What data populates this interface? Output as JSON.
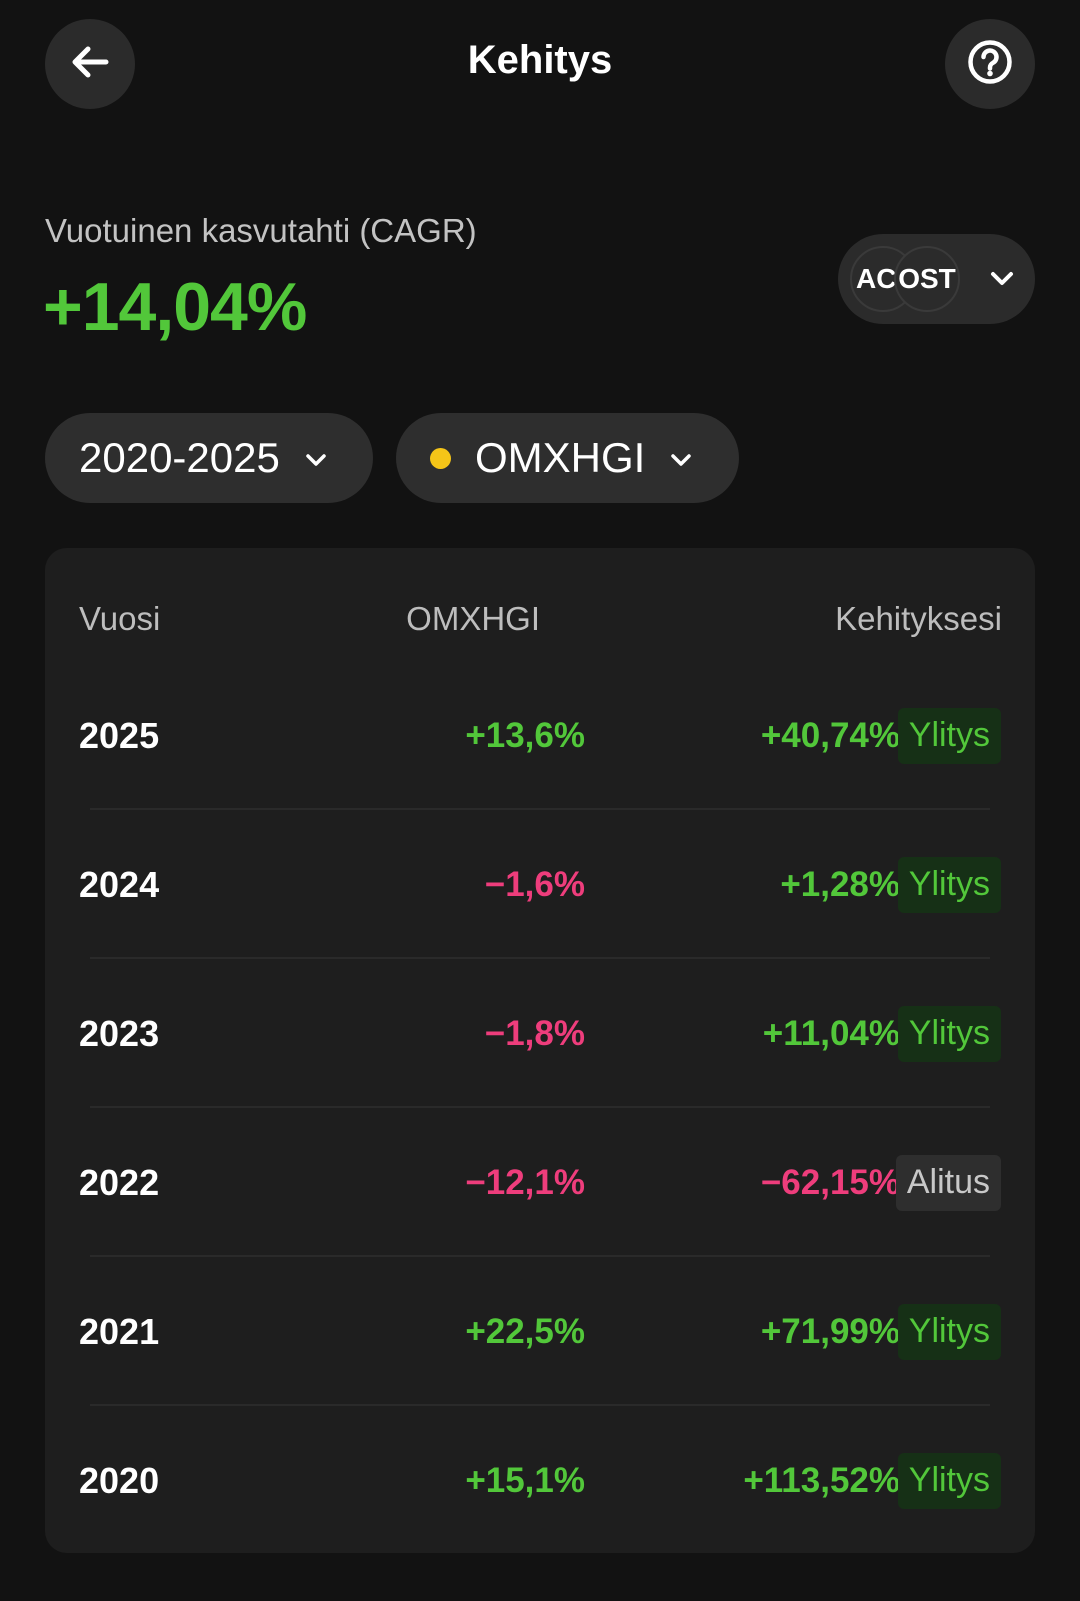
{
  "header": {
    "title": "Kehitys"
  },
  "cagr": {
    "label": "Vuotuinen kasvutahti (CAGR)",
    "value": "+14,04%"
  },
  "accounts": {
    "first": "AC",
    "second": "OST"
  },
  "filters": {
    "period": "2020-2025",
    "index": "OMXHGI",
    "index_dot_color": "#f5c518"
  },
  "table": {
    "headers": {
      "year": "Vuosi",
      "index": "OMXHGI",
      "mine": "Kehityksesi"
    },
    "rows": [
      {
        "year": "2025",
        "index": "+13,6%",
        "index_sign": "pos",
        "mine": "+40,74%",
        "mine_sign": "pos",
        "badge": "Ylitys",
        "badge_type": "over"
      },
      {
        "year": "2024",
        "index": "−1,6%",
        "index_sign": "neg",
        "mine": "+1,28%",
        "mine_sign": "pos",
        "badge": "Ylitys",
        "badge_type": "over"
      },
      {
        "year": "2023",
        "index": "−1,8%",
        "index_sign": "neg",
        "mine": "+11,04%",
        "mine_sign": "pos",
        "badge": "Ylitys",
        "badge_type": "over"
      },
      {
        "year": "2022",
        "index": "−12,1%",
        "index_sign": "neg",
        "mine": "−62,15%",
        "mine_sign": "neg",
        "badge": "Alitus",
        "badge_type": "under"
      },
      {
        "year": "2021",
        "index": "+22,5%",
        "index_sign": "pos",
        "mine": "+71,99%",
        "mine_sign": "pos",
        "badge": "Ylitys",
        "badge_type": "over"
      },
      {
        "year": "2020",
        "index": "+15,1%",
        "index_sign": "pos",
        "mine": "+113,52%",
        "mine_sign": "pos",
        "badge": "Ylitys",
        "badge_type": "over"
      }
    ]
  },
  "colors": {
    "positive": "#52c73a",
    "negative": "#ee3d7c",
    "background": "#121212",
    "card": "#1e1e1e"
  }
}
